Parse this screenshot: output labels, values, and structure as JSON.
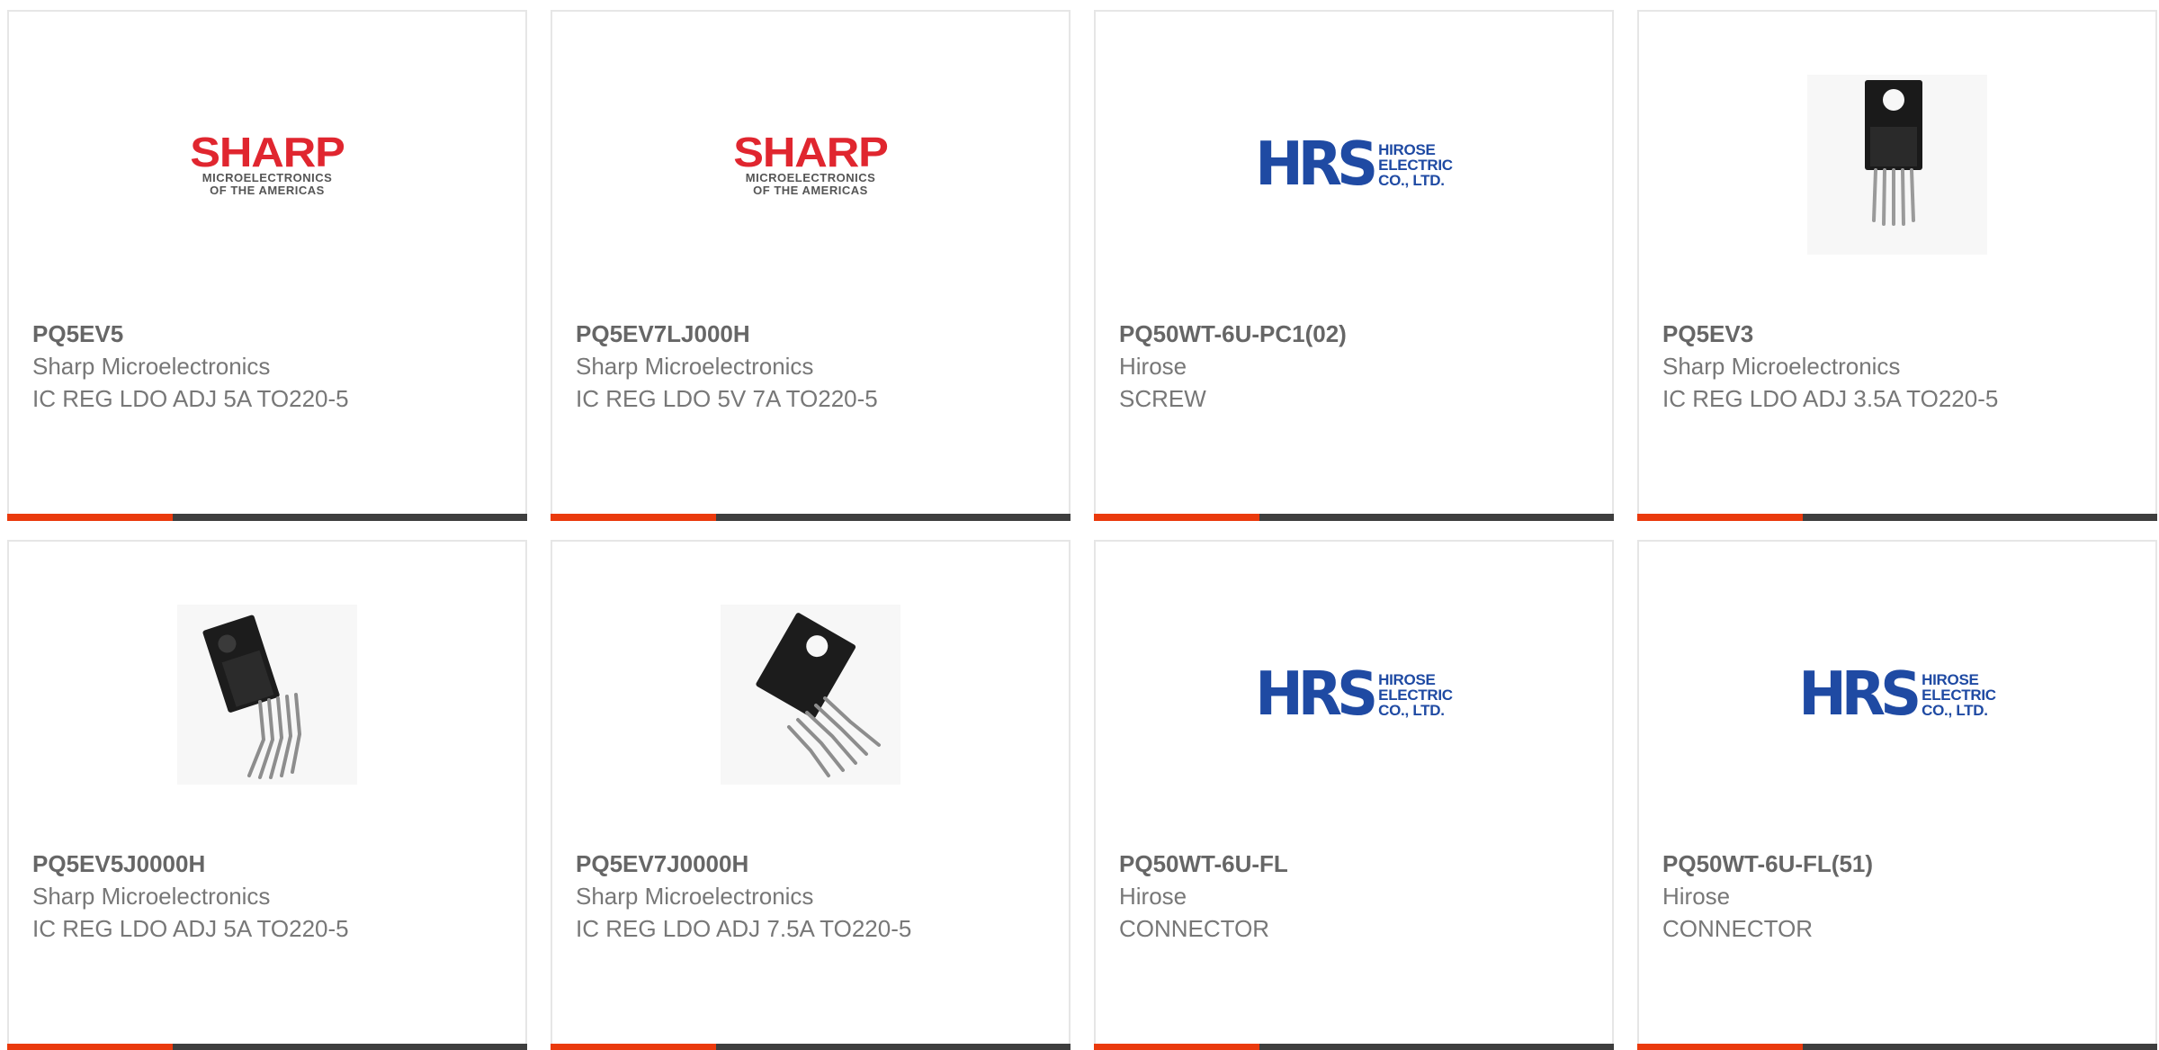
{
  "products": [
    {
      "part_number": "PQ5EV5",
      "manufacturer": "Sharp Microelectronics",
      "description": "IC REG LDO ADJ 5A TO220-5",
      "image_kind": "sharp-logo"
    },
    {
      "part_number": "PQ5EV7LJ000H",
      "manufacturer": "Sharp Microelectronics",
      "description": "IC REG LDO 5V 7A TO220-5",
      "image_kind": "sharp-logo"
    },
    {
      "part_number": "PQ50WT-6U-PC1(02)",
      "manufacturer": "Hirose",
      "description": "SCREW",
      "image_kind": "hirose-logo"
    },
    {
      "part_number": "PQ5EV3",
      "manufacturer": "Sharp Microelectronics",
      "description": "IC REG LDO ADJ 3.5A TO220-5",
      "image_kind": "to220-upright-photo"
    },
    {
      "part_number": "PQ5EV5J0000H",
      "manufacturer": "Sharp Microelectronics",
      "description": "IC REG LDO ADJ 5A TO220-5",
      "image_kind": "to220-tilted-photo"
    },
    {
      "part_number": "PQ5EV7J0000H",
      "manufacturer": "Sharp Microelectronics",
      "description": "IC REG LDO ADJ 7.5A TO220-5",
      "image_kind": "to220-angled-photo"
    },
    {
      "part_number": "PQ50WT-6U-FL",
      "manufacturer": "Hirose",
      "description": "CONNECTOR",
      "image_kind": "hirose-logo"
    },
    {
      "part_number": "PQ50WT-6U-FL(51)",
      "manufacturer": "Hirose",
      "description": "CONNECTOR",
      "image_kind": "hirose-logo"
    }
  ],
  "logos": {
    "sharp": {
      "word": "SHARP",
      "sub_line1": "MICROELECTRONICS",
      "sub_line2": "OF THE AMERICAS"
    },
    "hirose": {
      "mark": "HRS",
      "line1": "HIROSE",
      "line2": "ELECTRIC",
      "line3": "CO., LTD."
    }
  },
  "colors": {
    "accent": "#ea3a0d",
    "bar": "#3e3e3e",
    "sharp_red": "#e0262f",
    "hirose_blue": "#1f4aa3",
    "text": "#777777"
  }
}
